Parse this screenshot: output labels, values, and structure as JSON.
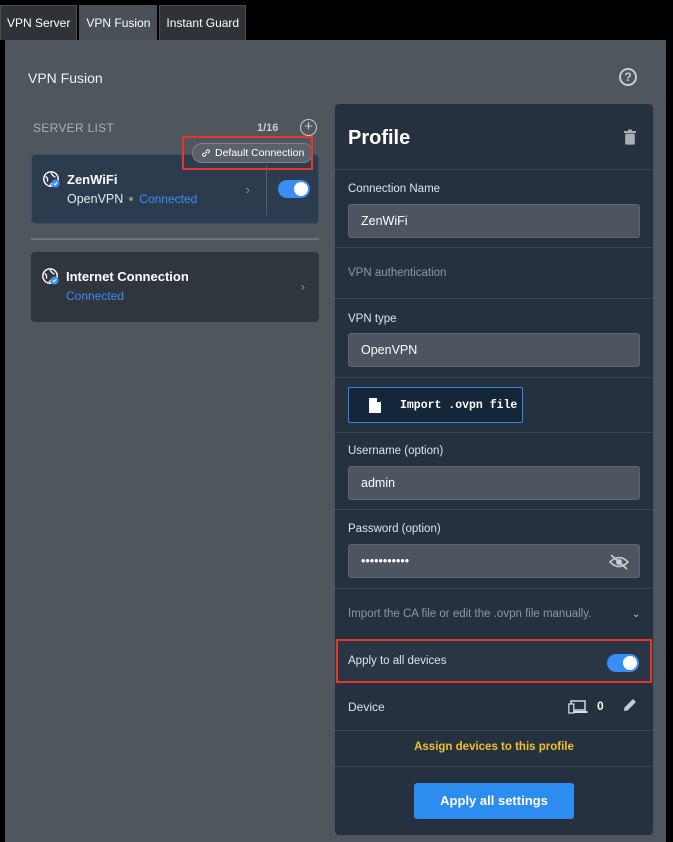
{
  "tabs": [
    {
      "label": "VPN Server"
    },
    {
      "label": "VPN Fusion",
      "active": true
    },
    {
      "label": "Instant Guard"
    }
  ],
  "page": {
    "title": "VPN Fusion",
    "help_icon": "question-circle-icon"
  },
  "server_list": {
    "label": "SERVER LIST",
    "count": "1/16",
    "default_badge": "Default Connection",
    "items": [
      {
        "name": "ZenWiFi",
        "protocol": "OpenVPN",
        "status": "Connected",
        "enabled": true
      },
      {
        "name": "Internet Connection",
        "status": "Connected"
      }
    ]
  },
  "profile": {
    "title": "Profile",
    "connection_name_label": "Connection Name",
    "connection_name_value": "ZenWiFi",
    "vpn_auth_label": "VPN authentication",
    "vpn_type_label": "VPN type",
    "vpn_type_value": "OpenVPN",
    "import_button": "Import .ovpn file",
    "username_label": "Username (option)",
    "username_value": "admin",
    "password_label": "Password (option)",
    "password_value": "•••••••••••",
    "ca_label": "Import the CA file or edit the .ovpn file manually.",
    "apply_all_label": "Apply to all devices",
    "apply_all_enabled": true,
    "device_label": "Device",
    "device_count": "0",
    "assign_link": "Assign devices to this profile",
    "apply_button": "Apply all settings"
  },
  "colors": {
    "accent": "#2d8cf0",
    "highlight": "#e4362b",
    "link": "#f0c02c",
    "status": "#3b8cf4"
  }
}
